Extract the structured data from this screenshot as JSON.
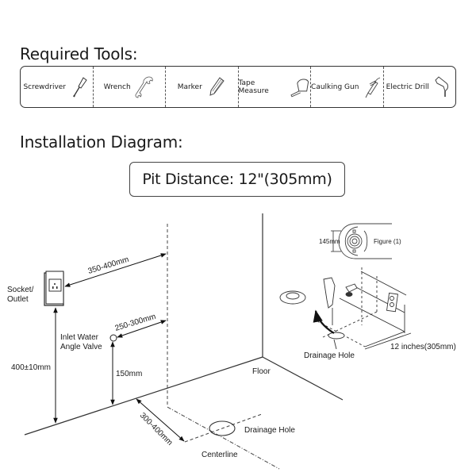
{
  "tools_section": {
    "title": "Required Tools:",
    "items": [
      {
        "label": "Screwdriver",
        "icon": "screwdriver-icon"
      },
      {
        "label": "Wrench",
        "icon": "wrench-icon"
      },
      {
        "label": "Marker",
        "icon": "marker-icon"
      },
      {
        "label": "Tape Measure",
        "icon": "tape-measure-icon"
      },
      {
        "label": "Caulking Gun",
        "icon": "caulking-gun-icon"
      },
      {
        "label": "Electric Drill",
        "icon": "electric-drill-icon"
      }
    ]
  },
  "diagram_section": {
    "title": "Installation Diagram:",
    "pit_distance": "Pit Distance: 12\"(305mm)",
    "labels": {
      "socket": [
        "Socket/",
        "Outlet"
      ],
      "inlet_valve": [
        "Inlet  Water",
        "Angle Valve"
      ],
      "dim_socket_to_centerline": "350-400mm",
      "dim_valve_to_centerline": "250-300mm",
      "dim_socket_height": "400±10mm",
      "dim_valve_height": "150mm",
      "dim_wall_to_drain": "300-400mm",
      "floor": "Floor",
      "drainage_hole": "Drainage Hole",
      "centerline": "Centerline",
      "figure_width": "145mm",
      "figure_caption": "Figure (1)",
      "inset_drainage_hole": "Drainage Hole",
      "inset_distance": "12 inches(305mm)"
    }
  }
}
